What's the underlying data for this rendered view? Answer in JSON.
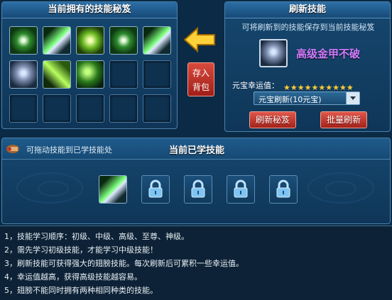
{
  "owned_panel": {
    "title": "当前拥有的技能秘笈",
    "store_button": {
      "line1": "存入",
      "line2": "背包"
    }
  },
  "refresh_panel": {
    "title": "刷新技能",
    "hint": "可将刷新到的技能保存到当前技能秘笈",
    "skill_name": "高级金甲不破",
    "luck_label": "元宝幸运值：",
    "luck_stars": 10,
    "luck_max": 10,
    "select_value": "元宝刷新(10元宝)",
    "refresh_button": "刷新秘笈",
    "batch_button": "批量刷新"
  },
  "learned_panel": {
    "drag_hint": "可拖动技能到已学技能处",
    "title": "当前已学技能"
  },
  "notes": [
    "1，技能学习顺序：初级、中级、高级、至尊、神级。",
    "2，需先学习初级技能，才能学习中级技能！",
    "3，刷新技能可获得强大的翅膀技能。每次刷新后可累积一些幸运值。",
    "4，幸运值越高，获得高级技能越容易。",
    "5，翅膀不能同时拥有两种相同种类的技能。"
  ],
  "colors": {
    "accent": "#ffcc33",
    "skill_name": "#d27cff",
    "button_red": "#c23a2e"
  }
}
